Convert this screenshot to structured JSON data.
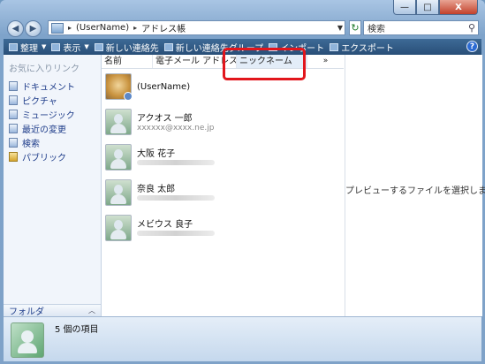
{
  "window": {
    "controls": {
      "minimize": "—",
      "maximize": "□",
      "close": "X"
    }
  },
  "address_bar": {
    "segments": [
      "(UserName)",
      "アドレス帳"
    ],
    "separator": "▸",
    "search_placeholder": "検索"
  },
  "toolbar": {
    "items": [
      {
        "label": "整理",
        "has_dropdown": true
      },
      {
        "label": "表示",
        "has_dropdown": true
      },
      {
        "label": "新しい連絡先",
        "has_dropdown": false
      },
      {
        "label": "新しい連絡先グループ",
        "has_dropdown": false
      },
      {
        "label": "インポート",
        "has_dropdown": false
      },
      {
        "label": "エクスポート",
        "has_dropdown": false
      }
    ],
    "help_label": "?"
  },
  "nav_pane": {
    "header": "お気に入りリンク",
    "items": [
      {
        "label": "ドキュメント",
        "icon": "documents-icon"
      },
      {
        "label": "ピクチャ",
        "icon": "pictures-icon"
      },
      {
        "label": "ミュージック",
        "icon": "music-icon"
      },
      {
        "label": "最近の変更",
        "icon": "recent-changes-icon"
      },
      {
        "label": "検索",
        "icon": "searches-icon"
      },
      {
        "label": "パブリック",
        "icon": "public-folder-icon"
      }
    ],
    "folder_label": "フォルダ",
    "folder_chevron": "︿"
  },
  "columns": [
    "名前",
    "電子メール アドレス",
    "ニックネーム"
  ],
  "columns_more": "»",
  "contacts": [
    {
      "name": "(UserName)",
      "email": "",
      "email_obscured": false,
      "avatar": "dog"
    },
    {
      "name": "アクオス 一郎",
      "email": "xxxxxx@xxxx.ne.jp",
      "email_obscured": false,
      "avatar": "person"
    },
    {
      "name": "大阪 花子",
      "email": "",
      "email_obscured": true,
      "avatar": "person"
    },
    {
      "name": "奈良 太郎",
      "email": "",
      "email_obscured": true,
      "avatar": "person"
    },
    {
      "name": "メビウス 良子",
      "email": "",
      "email_obscured": true,
      "avatar": "person"
    }
  ],
  "preview_message": "プレビューするファイルを選択します。",
  "details_pane": {
    "item_count": "5 個の項目"
  },
  "colors": {
    "toolbar": "#294f78",
    "highlight": "#e2161c",
    "link": "#1f3d8a"
  }
}
